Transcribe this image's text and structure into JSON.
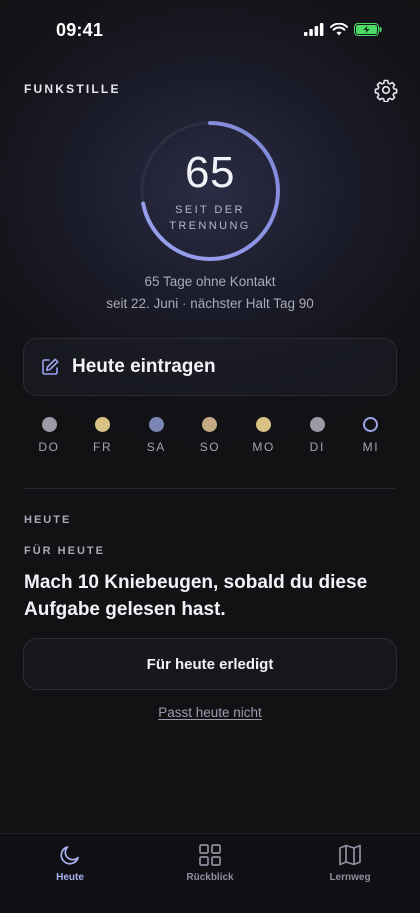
{
  "status_bar": {
    "time": "09:41"
  },
  "header": {
    "brand": "FUNKSTILLE"
  },
  "counter": {
    "value": "65",
    "caption_line1": "SEIT DER",
    "caption_line2": "TRENNUNG",
    "progress": 0.72,
    "summary": "65 Tage ohne Kontakt",
    "milestone": "seit 22. Juni · nächster Halt Tag 90"
  },
  "entry_button": {
    "label": "Heute eintragen"
  },
  "week": [
    {
      "label": "DO",
      "color": "#9b9ba8",
      "filled": true
    },
    {
      "label": "FR",
      "color": "#d8c184",
      "filled": true
    },
    {
      "label": "SA",
      "color": "#7b86b5",
      "filled": true
    },
    {
      "label": "SO",
      "color": "#c4ab86",
      "filled": true
    },
    {
      "label": "MO",
      "color": "#d8c184",
      "filled": true
    },
    {
      "label": "DI",
      "color": "#9b9ba8",
      "filled": true
    },
    {
      "label": "MI",
      "color": "#9ba6e6",
      "filled": false
    }
  ],
  "today": {
    "section_label": "HEUTE",
    "for_today_label": "FÜR HEUTE",
    "task": "Mach 10 Kniebeugen, sobald du diese Aufgabe gelesen hast.",
    "done_label": "Für heute erledigt",
    "skip_label": "Passt heute nicht"
  },
  "tabs": [
    {
      "label": "Heute",
      "icon": "moon-icon",
      "active": true
    },
    {
      "label": "Rückblick",
      "icon": "grid-icon",
      "active": false
    },
    {
      "label": "Lernweg",
      "icon": "map-icon",
      "active": false
    }
  ],
  "colors": {
    "accent": "#8f98e8",
    "tab_active": "#a9b2f2",
    "tab_inactive": "#8f909f",
    "battery": "#4cd964"
  }
}
